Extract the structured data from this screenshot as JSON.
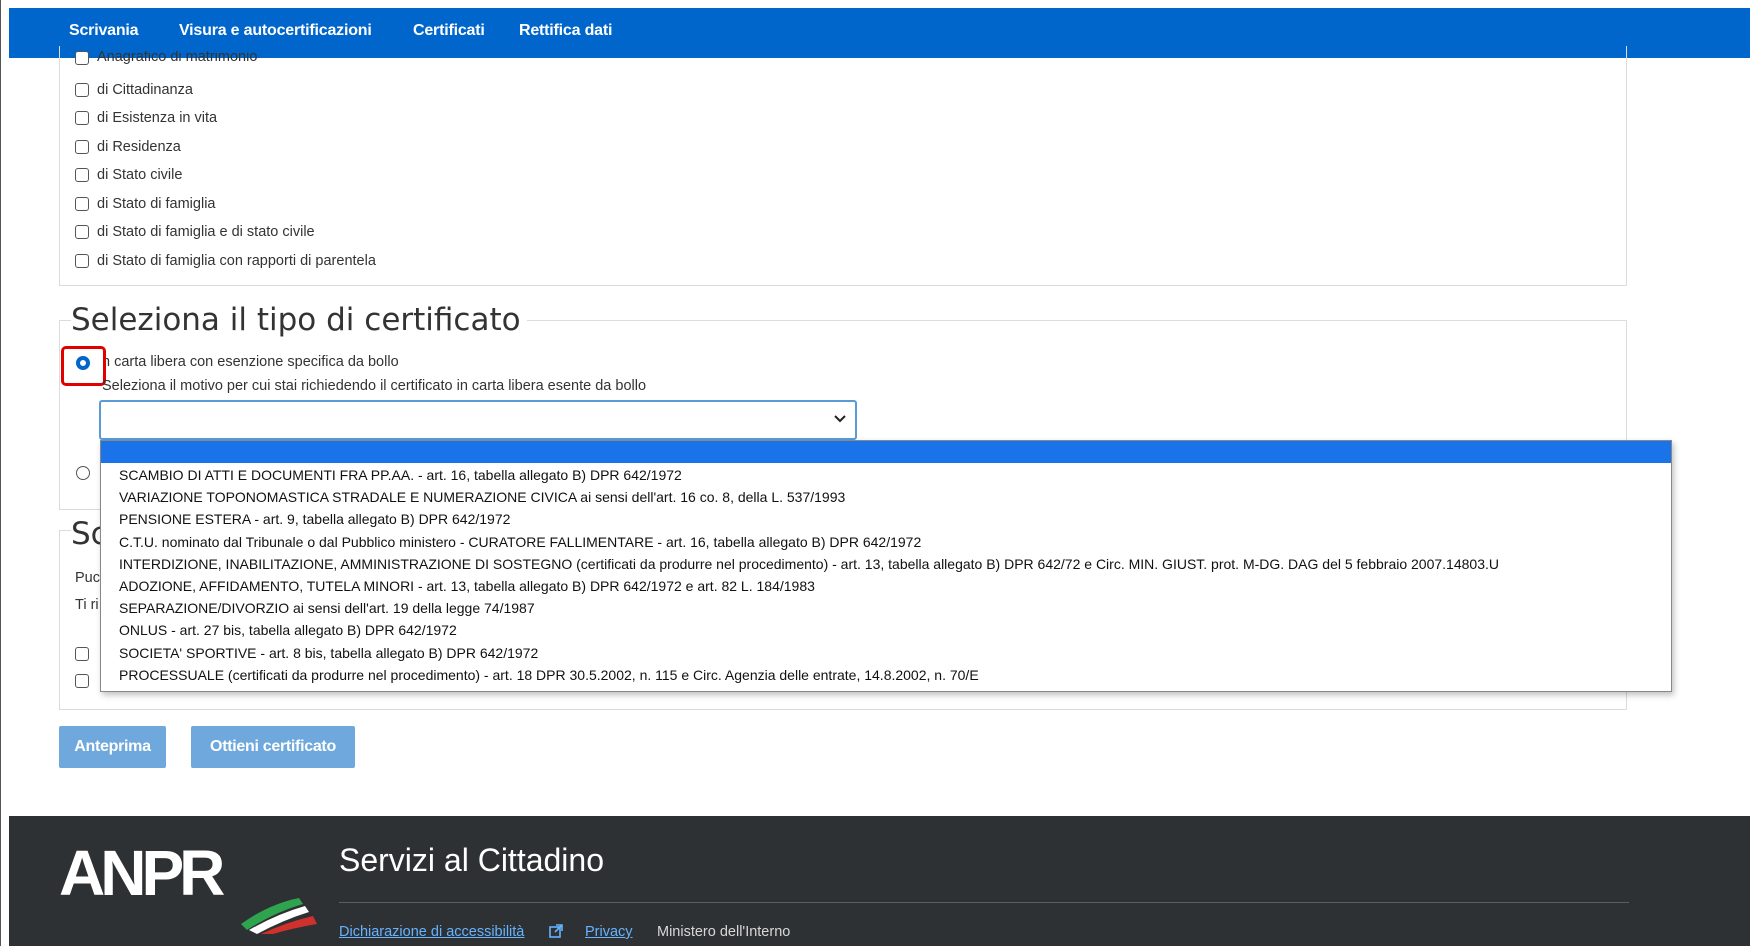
{
  "nav": {
    "items": [
      "Scrivania",
      "Visura e autocertificazioni",
      "Certificati",
      "Rettifica dati"
    ]
  },
  "certificates": {
    "partial_first": "Anagrafico di matrimonio",
    "items": [
      "di Cittadinanza",
      "di Esistenza in vita",
      "di Residenza",
      "di Stato civile",
      "di Stato di famiglia",
      "di Stato di famiglia e di stato civile",
      "di Stato di famiglia con rapporti di parentela"
    ]
  },
  "tipo": {
    "title": "Seleziona il tipo di certificato",
    "option1_label": "In carta libera con esenzione specifica da bollo",
    "option1_label_visible": "n carta libera con esenzione specifica da bollo",
    "select_prompt": "Seleziona il motivo per cui stai richiedendo il certificato in carta libera esente da bollo",
    "select_value": ""
  },
  "dropdown": {
    "options": [
      "SCAMBIO DI ATTI E DOCUMENTI FRA PP.AA. - art. 16, tabella allegato B) DPR 642/1972",
      "VARIAZIONE TOPONOMASTICA STRADALE E NUMERAZIONE CIVICA ai sensi dell'art. 16 co. 8, della L. 537/1993",
      "PENSIONE ESTERA - art. 9, tabella allegato B) DPR 642/1972",
      "C.T.U. nominato dal Tribunale o dal Pubblico ministero - CURATORE FALLIMENTARE - art. 16, tabella allegato B) DPR 642/1972",
      "INTERDIZIONE, INABILITAZIONE, AMMINISTRAZIONE DI SOSTEGNO (certificati da produrre nel procedimento) - art. 13, tabella allegato B) DPR 642/72 e Circ. MIN. GIUST. prot. M-DG. DAG del 5 febbraio 2007.14803.U",
      "ADOZIONE, AFFIDAMENTO, TUTELA MINORI - art. 13, tabella allegato B) DPR 642/1972 e art. 82 L. 184/1983",
      "SEPARAZIONE/DIVORZIO ai sensi dell'art. 19 della legge 74/1987",
      "ONLUS - art. 27 bis, tabella allegato B) DPR 642/1972",
      "SOCIETA' SPORTIVE - art. 8 bis, tabella allegato B) DPR 642/1972",
      "PROCESSUALE (certificati da produrre nel procedimento) - art. 18 DPR 30.5.2002, n. 115 e Circ. Agenzia delle entrate, 14.8.2002, n. 70/E"
    ]
  },
  "hidden_section": {
    "title_partial": "Sc",
    "line1_partial": "Puc",
    "line2_partial": "Ti ri"
  },
  "buttons": {
    "preview": "Anteprima",
    "get_certificate": "Ottieni certificato"
  },
  "footer": {
    "logo": "ANPR",
    "title": "Servizi al Cittadino",
    "accessibility": "Dichiarazione di accessibilità",
    "privacy": "Privacy",
    "ministry": "Ministero dell'Interno"
  },
  "colors": {
    "nav_bg": "#0066cc",
    "button_bg": "#6fa8dc",
    "dropdown_selected": "#1a73e8",
    "highlight": "#e00000",
    "footer_bg": "#2e3133"
  }
}
